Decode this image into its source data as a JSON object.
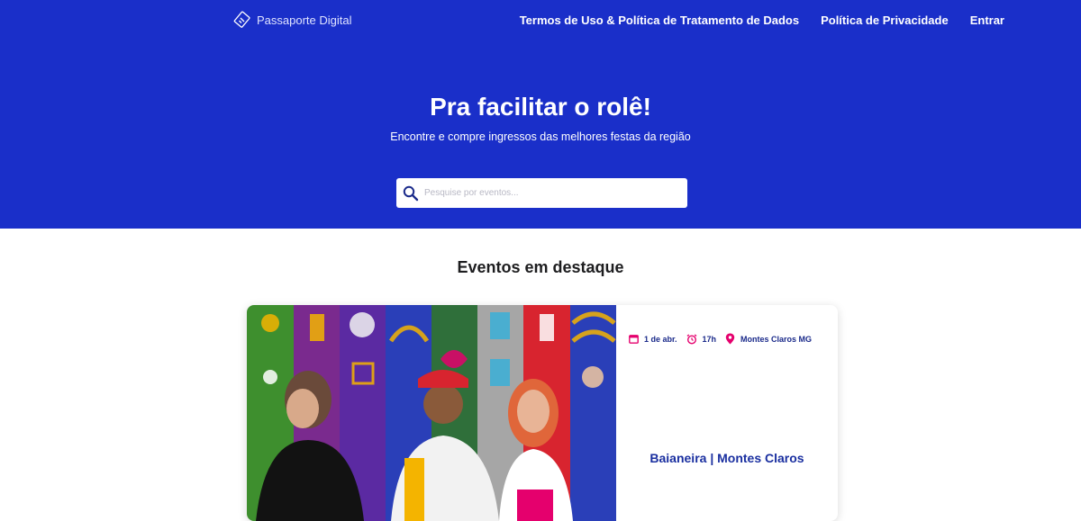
{
  "nav": {
    "brand": "Passaporte Digital",
    "links": [
      "Termos de Uso & Política de Tratamento de Dados",
      "Política de Privacidade",
      "Entrar"
    ]
  },
  "hero": {
    "title": "Pra facilitar o rolê!",
    "subtitle": "Encontre e compre ingressos das melhores festas da região",
    "search_placeholder": "Pesquise por eventos..."
  },
  "featured": {
    "title": "Eventos em destaque",
    "event": {
      "date": "1 de abr.",
      "time": "17h",
      "location": "Montes Claros MG",
      "name": "Baianeira | Montes Claros"
    }
  },
  "colors": {
    "primary": "#1a2fc9",
    "accent": "#e5006d",
    "event_title": "#1a2fa0"
  },
  "icons": [
    "passport-logo-icon",
    "search-icon",
    "calendar-icon",
    "alarm-clock-icon",
    "location-pin-icon"
  ]
}
